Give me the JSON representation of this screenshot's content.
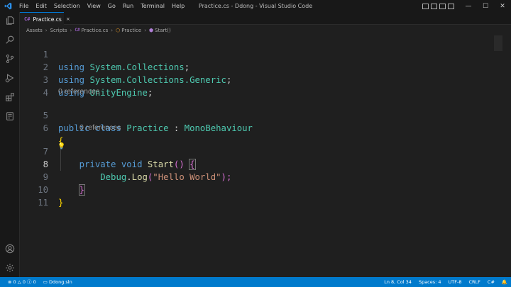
{
  "window": {
    "title": "Practice.cs - Ddong - Visual Studio Code",
    "accent": "#007acc"
  },
  "menu": [
    "File",
    "Edit",
    "Selection",
    "View",
    "Go",
    "Run",
    "Terminal",
    "Help"
  ],
  "activity_bar": {
    "top": [
      "files-icon",
      "search-icon",
      "source-control-icon",
      "run-debug-icon",
      "extensions-icon",
      "remote-explorer-icon"
    ],
    "bottom": [
      "account-icon",
      "gear-icon"
    ]
  },
  "tab": {
    "icon_text": "C#",
    "label": "Practice.cs",
    "close": "×"
  },
  "breadcrumb": {
    "items": [
      "Assets",
      "Scripts",
      "Practice.cs",
      "Practice",
      "Start()"
    ],
    "file_icon": "C#"
  },
  "editor": {
    "line_numbers": [
      "1",
      "2",
      "3",
      "4",
      "5",
      "6",
      "7",
      "8",
      "9",
      "10",
      "11"
    ],
    "active_line": "8",
    "codelens": [
      "0 references",
      "0 references"
    ],
    "tokens": {
      "using": "using",
      "ns1": "System.Collections",
      "ns2": "System.Collections.Generic",
      "ns3": "UnityEngine",
      "semi": ";",
      "public": "public",
      "class": "class",
      "class_name": "Practice",
      "colon": " : ",
      "base_class": "MonoBehaviour",
      "open_brace": "{",
      "close_brace": "}",
      "private": "private",
      "void": "void",
      "method": "Start",
      "parens": "()",
      "debug": "Debug",
      "dot": ".",
      "log": "Log",
      "lparen": "(",
      "string": "\"Hello World\"",
      "rparen_semi": ");"
    }
  },
  "status": {
    "errors": "0",
    "warnings": "0",
    "info": "0",
    "solution": "Ddong.sln",
    "position": "Ln 8, Col 34",
    "spaces": "Spaces: 4",
    "encoding": "UTF-8",
    "eol": "CRLF",
    "language": "C#"
  }
}
